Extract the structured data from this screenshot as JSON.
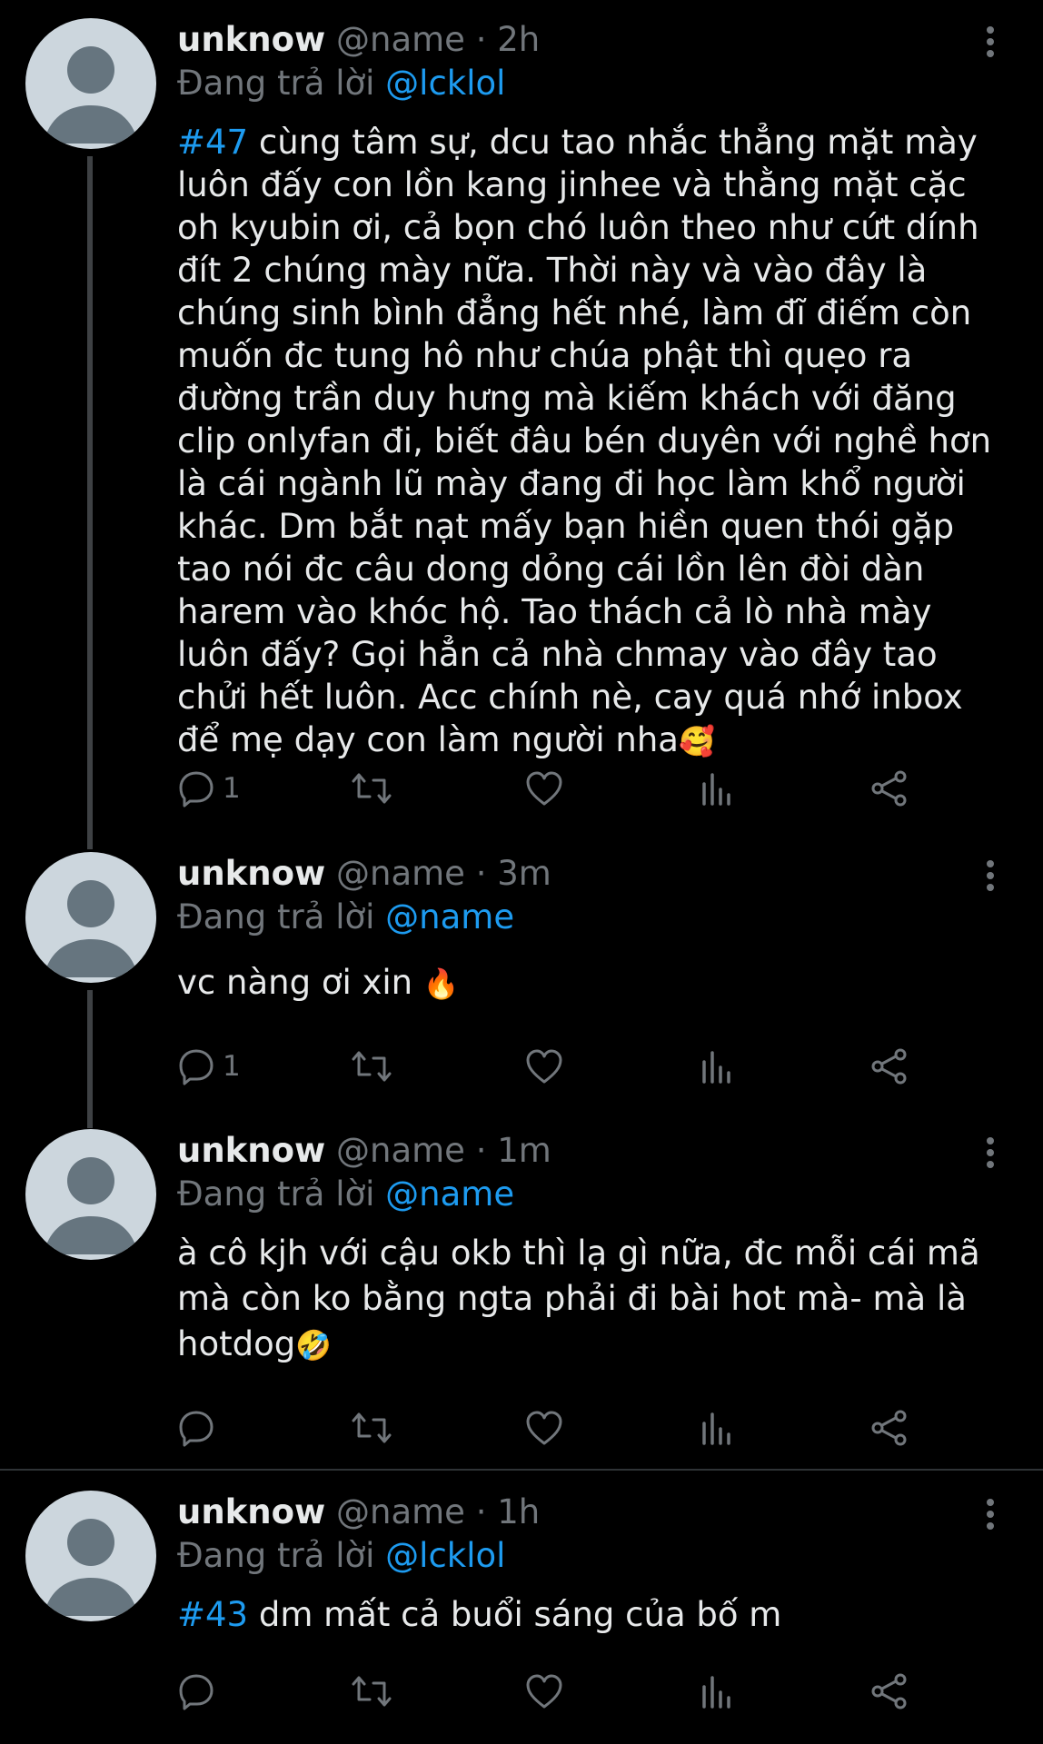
{
  "colors": {
    "background": "#000000",
    "text": "#e7e9ea",
    "secondary": "#71767b",
    "accent": "#1d9bf0",
    "thread_line": "#3e4144"
  },
  "tweets": [
    {
      "display_name": "unknow",
      "handle": "@name",
      "dot": "·",
      "time": "2h",
      "reply_prefix": "Đang trả lời",
      "reply_to": "@lcklol",
      "hashtag": "#47",
      "text": " cùng tâm sự, dcu tao nhắc thẳng mặt mày luôn đấy con lồn kang jinhee và thằng mặt cặc oh kyubin ơi, cả bọn chó luôn theo như cứt dính đít 2 chúng mày nữa. Thời này và vào đây là chúng sinh bình đẳng hết nhé, làm đĩ điếm còn muốn đc tung hô như chúa phật thì quẹo ra đường trần duy hưng mà kiếm khách với đăng clip onlyfan đi, biết đâu bén duyên với nghề hơn là cái ngành lũ mày đang đi học làm khổ người khác. Dm bắt nạt mấy bạn hiền quen thói gặp tao nói đc câu dong dỏng cái lồn lên đòi dàn harem vào khóc hộ. Tao thách cả lò nhà mày luôn đấy? Gọi hẳn cả nhà chmay vào đây tao chửi hết luôn. Acc chính nè, cay quá nhớ inbox để mẹ dạy con làm người nha",
      "emoji": "🥰",
      "reply_count": "1"
    },
    {
      "display_name": "unknow",
      "handle": "@name",
      "dot": "·",
      "time": "3m",
      "reply_prefix": "Đang trả lời",
      "reply_to": "@name",
      "text": "vc nàng ơi xin ",
      "emoji": "🔥",
      "reply_count": "1"
    },
    {
      "display_name": "unknow",
      "handle": "@name",
      "dot": "·",
      "time": "1m",
      "reply_prefix": "Đang trả lời",
      "reply_to": "@name",
      "text": "à cô kjh với cậu okb thì lạ gì nữa, đc mỗi cái mã mà còn ko bằng ngta phải đi bài hot mà- mà là hotdog",
      "emoji": "🤣",
      "reply_count": ""
    },
    {
      "display_name": "unknow",
      "handle": "@name",
      "dot": "·",
      "time": "1h",
      "reply_prefix": "Đang trả lời",
      "reply_to": "@lcklol",
      "hashtag": "#43",
      "text": " dm mất cả buổi sáng của bố m",
      "emoji": "",
      "reply_count": ""
    }
  ]
}
